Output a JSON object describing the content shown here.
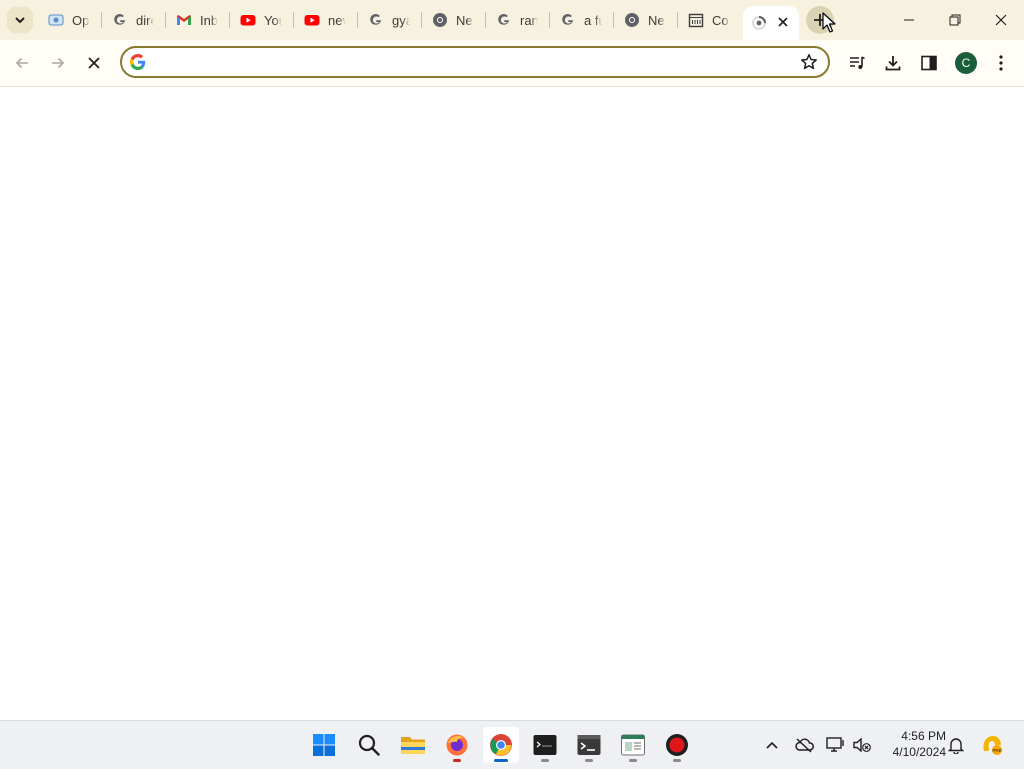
{
  "browser": {
    "tabs": [
      {
        "title": "Op",
        "icon": "openai-favicon-icon"
      },
      {
        "title": "dire",
        "icon": "google-g-icon"
      },
      {
        "title": "Inb",
        "icon": "gmail-icon"
      },
      {
        "title": "You",
        "icon": "youtube-icon"
      },
      {
        "title": "nev",
        "icon": "youtube-icon"
      },
      {
        "title": "gya",
        "icon": "google-g-icon"
      },
      {
        "title": "Ne",
        "icon": "chrome-newtab-icon"
      },
      {
        "title": "ran",
        "icon": "google-g-icon"
      },
      {
        "title": "a fu",
        "icon": "google-g-icon"
      },
      {
        "title": "Ne",
        "icon": "chrome-newtab-icon"
      },
      {
        "title": "Co",
        "icon": "calendar-icon"
      },
      {
        "title": "",
        "icon": "loading-spinner-icon",
        "active": true
      }
    ],
    "address_bar": {
      "value": "",
      "placeholder": ""
    },
    "profile_initial": "C",
    "colors": {
      "tabstrip": "#f7f2df",
      "omnibox_border": "#8a7a2d",
      "avatar": "#1b5e3a"
    }
  },
  "taskbar": {
    "apps": [
      {
        "name": "start-button",
        "icon": "windows-logo-icon"
      },
      {
        "name": "search",
        "icon": "search-icon"
      },
      {
        "name": "file-explorer",
        "icon": "folder-icon"
      },
      {
        "name": "firefox",
        "icon": "firefox-icon"
      },
      {
        "name": "chrome",
        "icon": "chrome-icon",
        "active": true
      },
      {
        "name": "terminal-dark",
        "icon": "terminal-icon"
      },
      {
        "name": "terminal",
        "icon": "command-prompt-icon"
      },
      {
        "name": "app-window",
        "icon": "window-app-icon"
      },
      {
        "name": "recorder",
        "icon": "record-icon"
      }
    ],
    "clock": {
      "time": "4:56 PM",
      "date": "4/10/2024"
    }
  }
}
